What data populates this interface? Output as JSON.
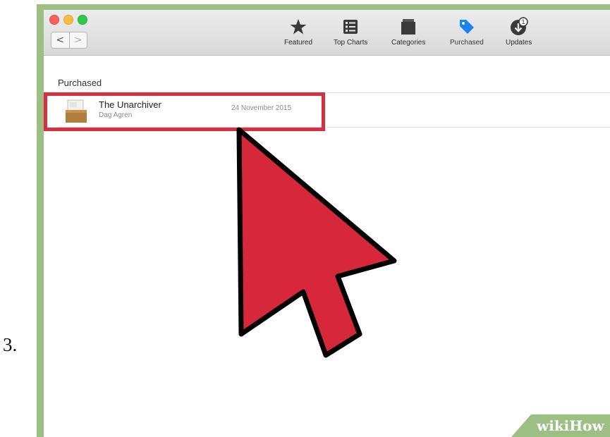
{
  "step_number": "3.",
  "toolbar": {
    "tabs": [
      {
        "label": "Featured",
        "icon": "star-icon"
      },
      {
        "label": "Top Charts",
        "icon": "list-icon"
      },
      {
        "label": "Categories",
        "icon": "box-icon"
      },
      {
        "label": "Purchased",
        "icon": "tag-icon"
      },
      {
        "label": "Updates",
        "icon": "updates-icon"
      }
    ],
    "updates_badge": "1",
    "selected_tab": "Purchased"
  },
  "nav": {
    "back": "<",
    "forward": ">"
  },
  "section_title": "Purchased",
  "purchased_items": [
    {
      "name": "The Unarchiver",
      "developer": "Dag Agren",
      "date": "24 November 2015",
      "icon": "archive-box-icon"
    }
  ],
  "watermark": {
    "wiki": "wiki",
    "how": "How"
  },
  "colors": {
    "frame_green": "#9dbf84",
    "highlight_red": "#d92e40",
    "arrow_red": "#d7283b",
    "accent_blue": "#1a82f7"
  }
}
